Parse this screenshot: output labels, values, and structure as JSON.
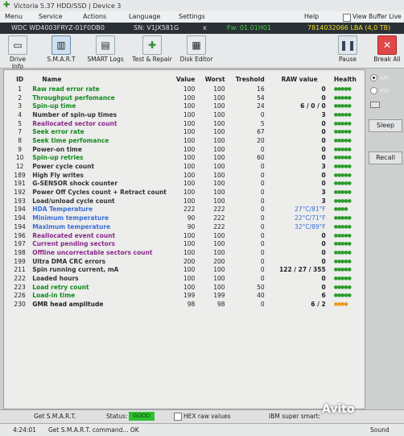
{
  "window": {
    "title": "Victoria 5.37 HDD/SSD | Device 3"
  },
  "menu": {
    "items": [
      "Menu",
      "Service",
      "Actions",
      "Language",
      "Settings",
      "Help"
    ],
    "buffer_label": "View Buffer Live"
  },
  "drive": {
    "model": "WDC WD4003FRYZ-01F0DB0",
    "serial": "SN: V1JX581G",
    "close": "x",
    "firmware": "Fw: 01.01H01",
    "capacity": "7814032066 LBA (4,0 TB)"
  },
  "toolbar": {
    "buttons": [
      {
        "label": "Drive Info",
        "icon": "drive-icon"
      },
      {
        "label": "S.M.A.R.T",
        "icon": "chart-icon"
      },
      {
        "label": "SMART Logs",
        "icon": "log-icon"
      },
      {
        "label": "Test & Repair",
        "icon": "plus-icon"
      },
      {
        "label": "Disk Editor",
        "icon": "grid-icon"
      }
    ],
    "pause_label": "Pause",
    "break_label": "Break All"
  },
  "smart": {
    "columns": [
      "ID",
      "Name",
      "Value",
      "Worst",
      "Treshold",
      "RAW value",
      "Health"
    ],
    "rows": [
      {
        "id": "1",
        "name": "Raw read error rate",
        "value": "100",
        "worst": "100",
        "thr": "16",
        "raw": "0",
        "health": "●●●●●",
        "kind": "green"
      },
      {
        "id": "2",
        "name": "Throughput perfomance",
        "value": "100",
        "worst": "100",
        "thr": "54",
        "raw": "0",
        "health": "●●●●●",
        "kind": "green"
      },
      {
        "id": "3",
        "name": "Spin-up time",
        "value": "100",
        "worst": "100",
        "thr": "24",
        "raw": "6 / 0 / 0",
        "health": "●●●●●",
        "kind": "green"
      },
      {
        "id": "4",
        "name": "Number of spin-up times",
        "value": "100",
        "worst": "100",
        "thr": "0",
        "raw": "3",
        "health": "●●●●●",
        "kind": "ok"
      },
      {
        "id": "5",
        "name": "Reallocated sector count",
        "value": "100",
        "worst": "100",
        "thr": "5",
        "raw": "0",
        "health": "●●●●●",
        "kind": "purple"
      },
      {
        "id": "7",
        "name": "Seek error rate",
        "value": "100",
        "worst": "100",
        "thr": "67",
        "raw": "0",
        "health": "●●●●●",
        "kind": "green"
      },
      {
        "id": "8",
        "name": "Seek time perfomance",
        "value": "100",
        "worst": "100",
        "thr": "20",
        "raw": "0",
        "health": "●●●●●",
        "kind": "green"
      },
      {
        "id": "9",
        "name": "Power-on time",
        "value": "100",
        "worst": "100",
        "thr": "0",
        "raw": "0",
        "health": "●●●●●",
        "kind": "ok"
      },
      {
        "id": "10",
        "name": "Spin-up retries",
        "value": "100",
        "worst": "100",
        "thr": "60",
        "raw": "0",
        "health": "●●●●●",
        "kind": "green"
      },
      {
        "id": "12",
        "name": "Power cycle count",
        "value": "100",
        "worst": "100",
        "thr": "0",
        "raw": "3",
        "health": "●●●●●",
        "kind": "ok"
      },
      {
        "id": "189",
        "name": "High Fly writes",
        "value": "100",
        "worst": "100",
        "thr": "0",
        "raw": "0",
        "health": "●●●●●",
        "kind": "ok"
      },
      {
        "id": "191",
        "name": "G-SENSOR shock counter",
        "value": "100",
        "worst": "100",
        "thr": "0",
        "raw": "0",
        "health": "●●●●●",
        "kind": "ok"
      },
      {
        "id": "192",
        "name": "Power Off Cycles count + Retract count",
        "value": "100",
        "worst": "100",
        "thr": "0",
        "raw": "3",
        "health": "●●●●●",
        "kind": "ok"
      },
      {
        "id": "193",
        "name": "Load/unload cycle count",
        "value": "100",
        "worst": "100",
        "thr": "0",
        "raw": "3",
        "health": "●●●●●",
        "kind": "ok"
      },
      {
        "id": "194",
        "name": "HDA Temperature",
        "value": "222",
        "worst": "222",
        "thr": "0",
        "raw": "27°C/81°F",
        "health": "●●●●",
        "kind": "blue"
      },
      {
        "id": "194",
        "name": "Minimum temperature",
        "value": "90",
        "worst": "222",
        "thr": "0",
        "raw": "22°C/71°F",
        "health": "●●●●●",
        "kind": "blue"
      },
      {
        "id": "194",
        "name": "Maximum temperature",
        "value": "90",
        "worst": "222",
        "thr": "0",
        "raw": "32°C/89°F",
        "health": "●●●●●",
        "kind": "blue"
      },
      {
        "id": "196",
        "name": "Reallocated event count",
        "value": "100",
        "worst": "100",
        "thr": "0",
        "raw": "0",
        "health": "●●●●●",
        "kind": "purple"
      },
      {
        "id": "197",
        "name": "Current pending sectors",
        "value": "100",
        "worst": "100",
        "thr": "0",
        "raw": "0",
        "health": "●●●●●",
        "kind": "purple"
      },
      {
        "id": "198",
        "name": "Offline uncorrectable sectors count",
        "value": "100",
        "worst": "100",
        "thr": "0",
        "raw": "0",
        "health": "●●●●●",
        "kind": "purple"
      },
      {
        "id": "199",
        "name": "Ultra DMA CRC errors",
        "value": "200",
        "worst": "200",
        "thr": "0",
        "raw": "0",
        "health": "●●●●●",
        "kind": "ok"
      },
      {
        "id": "211",
        "name": "Spin running current, mA",
        "value": "100",
        "worst": "100",
        "thr": "0",
        "raw": "122 / 27 / 355",
        "health": "●●●●●",
        "kind": "ok"
      },
      {
        "id": "222",
        "name": "Loaded hours",
        "value": "100",
        "worst": "100",
        "thr": "0",
        "raw": "0",
        "health": "●●●●●",
        "kind": "ok"
      },
      {
        "id": "223",
        "name": "Load retry count",
        "value": "100",
        "worst": "100",
        "thr": "50",
        "raw": "0",
        "health": "●●●●●",
        "kind": "green"
      },
      {
        "id": "226",
        "name": "Load-in time",
        "value": "199",
        "worst": "199",
        "thr": "40",
        "raw": "6",
        "health": "●●●●●",
        "kind": "green"
      },
      {
        "id": "230",
        "name": "GMR head amplitude",
        "value": "98",
        "worst": "98",
        "thr": "0",
        "raw": "6 / 2",
        "health": "●●●●",
        "kind": "warn"
      }
    ]
  },
  "side": {
    "api": "API",
    "pio": "PIO",
    "sleep": "Sleep",
    "recall": "Recall"
  },
  "status": {
    "get_smart": "Get S.M.A.R.T.",
    "status_label": "Status:",
    "status_value": "GOOD",
    "hex_label": "HEX raw values",
    "ibm_label": "IBM super smart:"
  },
  "log": {
    "time": "4:24:01",
    "message": "Get S.M.A.R.T. command... OK",
    "sound": "Sound"
  },
  "watermark": "Avito"
}
